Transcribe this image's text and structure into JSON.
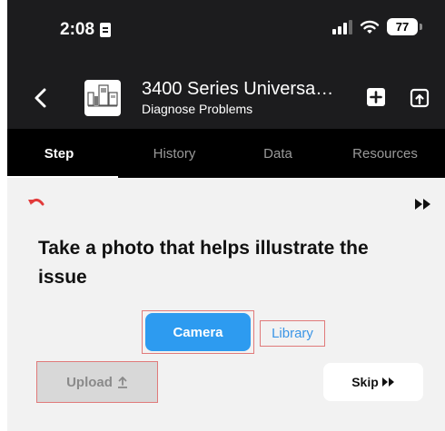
{
  "status_bar": {
    "time": "2:08",
    "battery": "77"
  },
  "nav": {
    "title": "3400 Series Universa…",
    "subtitle": "Diagnose Problems",
    "back_icon": "chevron-left-icon",
    "add_icon": "plus-square-icon",
    "share_icon": "upload-square-icon"
  },
  "tabs": [
    {
      "label": "Step",
      "active": true
    },
    {
      "label": "History",
      "active": false
    },
    {
      "label": "Data",
      "active": false
    },
    {
      "label": "Resources",
      "active": false
    }
  ],
  "step": {
    "prompt": "Take a photo that helps illustrate the issue",
    "camera_label": "Camera",
    "library_label": "Library",
    "upload_label": "Upload",
    "skip_label": "Skip",
    "undo_icon": "undo-arrow-icon",
    "fast_forward_icon": "fast-forward-icon"
  },
  "colors": {
    "header_bg": "#1c1c1e",
    "tab_bg": "#000000",
    "accent_blue": "#2d9bf0",
    "undo_red": "#e23b3b",
    "highlight_outline": "#e07a7a"
  }
}
